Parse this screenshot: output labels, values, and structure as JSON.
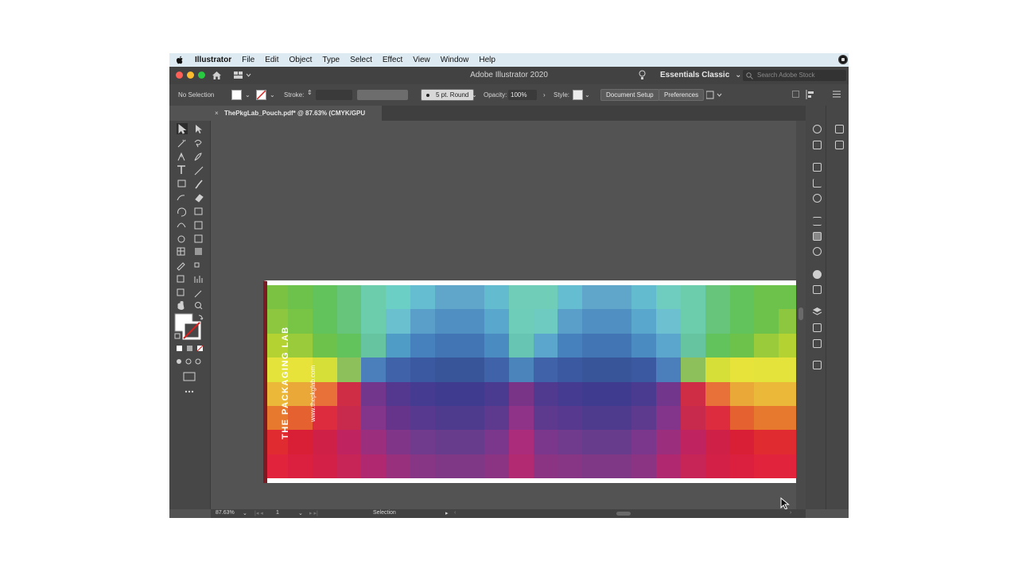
{
  "menubar": {
    "app_name": "Illustrator",
    "items": [
      "File",
      "Edit",
      "Object",
      "Type",
      "Select",
      "Effect",
      "View",
      "Window",
      "Help"
    ]
  },
  "titlebar": {
    "title": "Adobe Illustrator 2020",
    "workspace": "Essentials Classic",
    "search_placeholder": "Search Adobe Stock"
  },
  "control": {
    "selection": "No Selection",
    "stroke_label": "Stroke:",
    "brush": "5 pt. Round",
    "opacity_label": "Opacity:",
    "opacity_value": "100%",
    "style_label": "Style:",
    "document_setup": "Document Setup",
    "preferences": "Preferences"
  },
  "tab": {
    "close": "×",
    "title": "ThePkgLab_Pouch.pdf* @ 87.63% (CMYK/GPU Preview)"
  },
  "artwork": {
    "brand_text": "THE PACKAGING LAB",
    "url_text": "www.thepkglab.com"
  },
  "status": {
    "zoom": "87.63%",
    "artboard": "1",
    "tool": "Selection"
  },
  "colors": {
    "traffic_close": "#fe5f57",
    "traffic_min": "#febc2e",
    "traffic_max": "#28c840",
    "panel_bg": "#474747",
    "canvas_bg": "#535353"
  },
  "icons": [
    "apple-icon",
    "home-icon",
    "workspace-switcher-icon",
    "lightbulb-icon",
    "search-icon",
    "selection-tool-icon",
    "direct-selection-tool-icon",
    "hand-tool-icon",
    "zoom-tool-icon",
    "more-tools-icon",
    "layers-icon",
    "mouse-cursor-icon"
  ]
}
